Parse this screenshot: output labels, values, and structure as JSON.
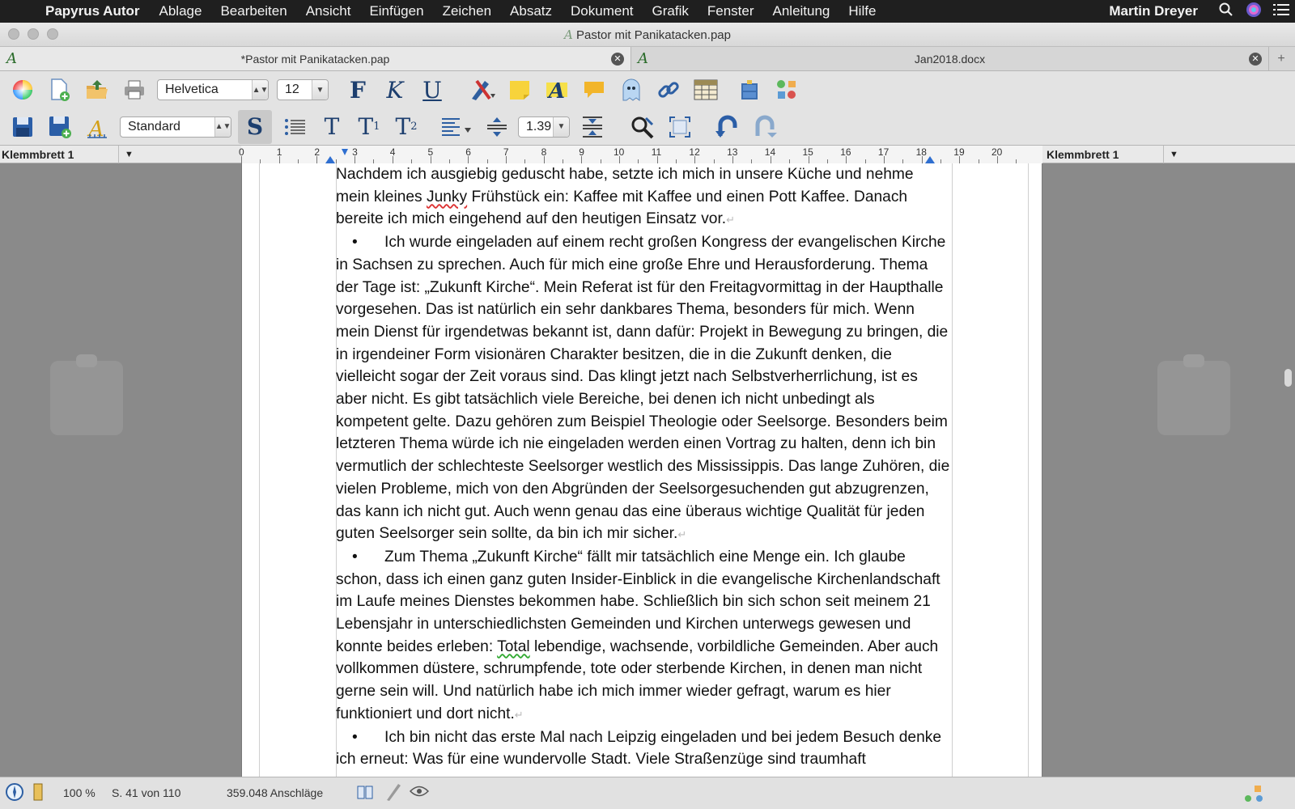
{
  "menubar": {
    "app_name": "Papyrus Autor",
    "items": [
      "Ablage",
      "Bearbeiten",
      "Ansicht",
      "Einfügen",
      "Zeichen",
      "Absatz",
      "Dokument",
      "Grafik",
      "Fenster",
      "Anleitung",
      "Hilfe"
    ],
    "user": "Martin Dreyer"
  },
  "window": {
    "title": "Pastor mit Panikatacken.pap"
  },
  "tabs": [
    {
      "label": "*Pastor mit Panikatacken.pap",
      "active": true
    },
    {
      "label": "Jan2018.docx",
      "active": false
    }
  ],
  "toolbar1": {
    "font": "Helvetica",
    "size": "12",
    "bold_label": "F",
    "italic_label": "K",
    "underline_label": "U"
  },
  "toolbar2": {
    "style": "Standard",
    "standard_label": "S",
    "t_label": "T",
    "t1_label": "T",
    "t2_label": "T",
    "t1_sub": "1",
    "t2_sub": "2",
    "line_spacing": "1.39"
  },
  "clipboards": {
    "left": "Klemmbrett 1",
    "right": "Klemmbrett 1"
  },
  "ruler": {
    "numbers": [
      "0",
      "1",
      "2",
      "3",
      "4",
      "5",
      "6",
      "7",
      "8",
      "9",
      "10",
      "11",
      "12",
      "13",
      "14",
      "15",
      "16",
      "17",
      "18",
      "19",
      "20"
    ]
  },
  "document": {
    "p1": "Nachdem ich ausgiebig geduscht habe, setzte ich mich in unsere Küche und nehme mein kleines ",
    "p1_err": "Junky",
    "p1b": " Frühstück ein: Kaffee mit Kaffee und einen Pott Kaffee. Danach bereite ich mich eingehend auf den heutigen Einsatz vor.",
    "b1": "Ich wurde eingeladen auf einem recht großen Kongress der evangelischen Kirche in Sachsen zu sprechen. Auch für mich eine große Ehre und Herausforderung. Thema der Tage ist: „Zukunft Kirche“. Mein Referat ist für den Freitagvormittag in der Haupthalle vorgesehen. Das ist natürlich ein sehr dankbares Thema, besonders für mich. Wenn mein Dienst für irgendetwas bekannt ist, dann dafür: Projekt in Bewegung zu bringen, die in irgendeiner Form visionären Charakter besitzen, die in die Zukunft denken, die vielleicht sogar der Zeit voraus sind. Das klingt jetzt nach Selbstverherrlichung, ist es aber nicht. Es gibt tatsächlich viele Bereiche, bei denen ich nicht unbedingt als kompetent gelte. Dazu gehören zum Beispiel Theologie oder Seelsorge. Besonders beim letzteren Thema würde ich nie eingeladen werden einen Vortrag zu halten, denn ich bin vermutlich der schlechteste Seelsorger westlich des Mississippis. Das lange Zuhören, die vielen Probleme, mich von den Abgründen der Seelsorgesuchenden gut abzugrenzen, das kann ich nicht gut. Auch wenn genau das eine überaus wichtige Qualität für jeden guten Seelsorger sein sollte, da bin ich mir sicher.",
    "b2a": "Zum Thema „Zukunft Kirche“ fällt mir tatsächlich eine Menge ein. Ich glaube schon, dass ich einen ganz guten Insider-Einblick in die evangelische Kirchenlandschaft im Laufe meines Dienstes bekommen habe. Schließlich bin sich schon seit meinem 21 Lebensjahr in unterschiedlichsten Gemeinden und Kirchen unterwegs gewesen und konnte beides erleben: ",
    "b2_err": "Total",
    "b2b": " lebendige, wachsende, vorbildliche Gemeinden. Aber auch vollkommen düstere, schrumpfende, tote oder sterbende Kirchen, in denen man nicht gerne sein will. Und natürlich habe ich mich immer wieder gefragt, warum es hier funktioniert und dort nicht.",
    "b3": "Ich bin nicht das erste Mal nach Leipzig eingeladen und bei jedem Besuch denke ich erneut: Was für eine wundervolle Stadt. Viele Straßenzüge sind traumhaft",
    "bullet": "•",
    "pilcrow": "↵"
  },
  "status": {
    "zoom": "100 %",
    "page": "S. 41 von 110",
    "chars": "359.048 Anschläge"
  }
}
